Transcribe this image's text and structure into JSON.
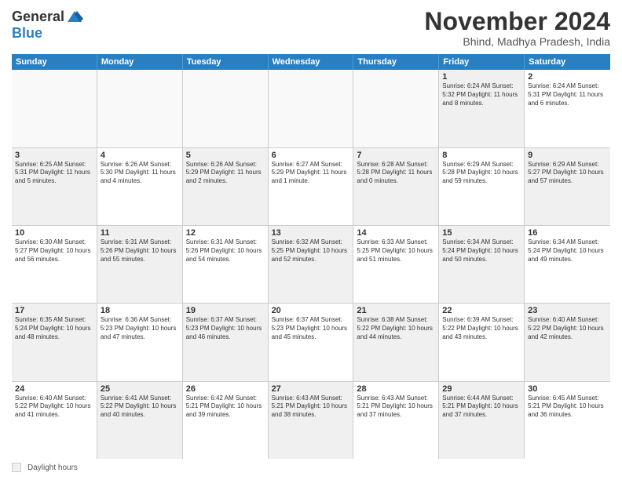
{
  "logo": {
    "general": "General",
    "blue": "Blue"
  },
  "title": "November 2024",
  "location": "Bhind, Madhya Pradesh, India",
  "days_of_week": [
    "Sunday",
    "Monday",
    "Tuesday",
    "Wednesday",
    "Thursday",
    "Friday",
    "Saturday"
  ],
  "legend": {
    "label": "Daylight hours"
  },
  "weeks": [
    [
      {
        "day": "",
        "detail": "",
        "empty": true
      },
      {
        "day": "",
        "detail": "",
        "empty": true
      },
      {
        "day": "",
        "detail": "",
        "empty": true
      },
      {
        "day": "",
        "detail": "",
        "empty": true
      },
      {
        "day": "",
        "detail": "",
        "empty": true
      },
      {
        "day": "1",
        "detail": "Sunrise: 6:24 AM\nSunset: 5:32 PM\nDaylight: 11 hours\nand 8 minutes.",
        "shaded": true
      },
      {
        "day": "2",
        "detail": "Sunrise: 6:24 AM\nSunset: 5:31 PM\nDaylight: 11 hours\nand 6 minutes.",
        "shaded": false
      }
    ],
    [
      {
        "day": "3",
        "detail": "Sunrise: 6:25 AM\nSunset: 5:31 PM\nDaylight: 11 hours\nand 5 minutes.",
        "shaded": true
      },
      {
        "day": "4",
        "detail": "Sunrise: 6:26 AM\nSunset: 5:30 PM\nDaylight: 11 hours\nand 4 minutes.",
        "shaded": false
      },
      {
        "day": "5",
        "detail": "Sunrise: 6:26 AM\nSunset: 5:29 PM\nDaylight: 11 hours\nand 2 minutes.",
        "shaded": true
      },
      {
        "day": "6",
        "detail": "Sunrise: 6:27 AM\nSunset: 5:29 PM\nDaylight: 11 hours\nand 1 minute.",
        "shaded": false
      },
      {
        "day": "7",
        "detail": "Sunrise: 6:28 AM\nSunset: 5:28 PM\nDaylight: 11 hours\nand 0 minutes.",
        "shaded": true
      },
      {
        "day": "8",
        "detail": "Sunrise: 6:29 AM\nSunset: 5:28 PM\nDaylight: 10 hours\nand 59 minutes.",
        "shaded": false
      },
      {
        "day": "9",
        "detail": "Sunrise: 6:29 AM\nSunset: 5:27 PM\nDaylight: 10 hours\nand 57 minutes.",
        "shaded": true
      }
    ],
    [
      {
        "day": "10",
        "detail": "Sunrise: 6:30 AM\nSunset: 5:27 PM\nDaylight: 10 hours\nand 56 minutes.",
        "shaded": false
      },
      {
        "day": "11",
        "detail": "Sunrise: 6:31 AM\nSunset: 5:26 PM\nDaylight: 10 hours\nand 55 minutes.",
        "shaded": true
      },
      {
        "day": "12",
        "detail": "Sunrise: 6:31 AM\nSunset: 5:26 PM\nDaylight: 10 hours\nand 54 minutes.",
        "shaded": false
      },
      {
        "day": "13",
        "detail": "Sunrise: 6:32 AM\nSunset: 5:25 PM\nDaylight: 10 hours\nand 52 minutes.",
        "shaded": true
      },
      {
        "day": "14",
        "detail": "Sunrise: 6:33 AM\nSunset: 5:25 PM\nDaylight: 10 hours\nand 51 minutes.",
        "shaded": false
      },
      {
        "day": "15",
        "detail": "Sunrise: 6:34 AM\nSunset: 5:24 PM\nDaylight: 10 hours\nand 50 minutes.",
        "shaded": true
      },
      {
        "day": "16",
        "detail": "Sunrise: 6:34 AM\nSunset: 5:24 PM\nDaylight: 10 hours\nand 49 minutes.",
        "shaded": false
      }
    ],
    [
      {
        "day": "17",
        "detail": "Sunrise: 6:35 AM\nSunset: 5:24 PM\nDaylight: 10 hours\nand 48 minutes.",
        "shaded": true
      },
      {
        "day": "18",
        "detail": "Sunrise: 6:36 AM\nSunset: 5:23 PM\nDaylight: 10 hours\nand 47 minutes.",
        "shaded": false
      },
      {
        "day": "19",
        "detail": "Sunrise: 6:37 AM\nSunset: 5:23 PM\nDaylight: 10 hours\nand 46 minutes.",
        "shaded": true
      },
      {
        "day": "20",
        "detail": "Sunrise: 6:37 AM\nSunset: 5:23 PM\nDaylight: 10 hours\nand 45 minutes.",
        "shaded": false
      },
      {
        "day": "21",
        "detail": "Sunrise: 6:38 AM\nSunset: 5:22 PM\nDaylight: 10 hours\nand 44 minutes.",
        "shaded": true
      },
      {
        "day": "22",
        "detail": "Sunrise: 6:39 AM\nSunset: 5:22 PM\nDaylight: 10 hours\nand 43 minutes.",
        "shaded": false
      },
      {
        "day": "23",
        "detail": "Sunrise: 6:40 AM\nSunset: 5:22 PM\nDaylight: 10 hours\nand 42 minutes.",
        "shaded": true
      }
    ],
    [
      {
        "day": "24",
        "detail": "Sunrise: 6:40 AM\nSunset: 5:22 PM\nDaylight: 10 hours\nand 41 minutes.",
        "shaded": false
      },
      {
        "day": "25",
        "detail": "Sunrise: 6:41 AM\nSunset: 5:22 PM\nDaylight: 10 hours\nand 40 minutes.",
        "shaded": true
      },
      {
        "day": "26",
        "detail": "Sunrise: 6:42 AM\nSunset: 5:21 PM\nDaylight: 10 hours\nand 39 minutes.",
        "shaded": false
      },
      {
        "day": "27",
        "detail": "Sunrise: 6:43 AM\nSunset: 5:21 PM\nDaylight: 10 hours\nand 38 minutes.",
        "shaded": true
      },
      {
        "day": "28",
        "detail": "Sunrise: 6:43 AM\nSunset: 5:21 PM\nDaylight: 10 hours\nand 37 minutes.",
        "shaded": false
      },
      {
        "day": "29",
        "detail": "Sunrise: 6:44 AM\nSunset: 5:21 PM\nDaylight: 10 hours\nand 37 minutes.",
        "shaded": true
      },
      {
        "day": "30",
        "detail": "Sunrise: 6:45 AM\nSunset: 5:21 PM\nDaylight: 10 hours\nand 36 minutes.",
        "shaded": false
      }
    ]
  ]
}
